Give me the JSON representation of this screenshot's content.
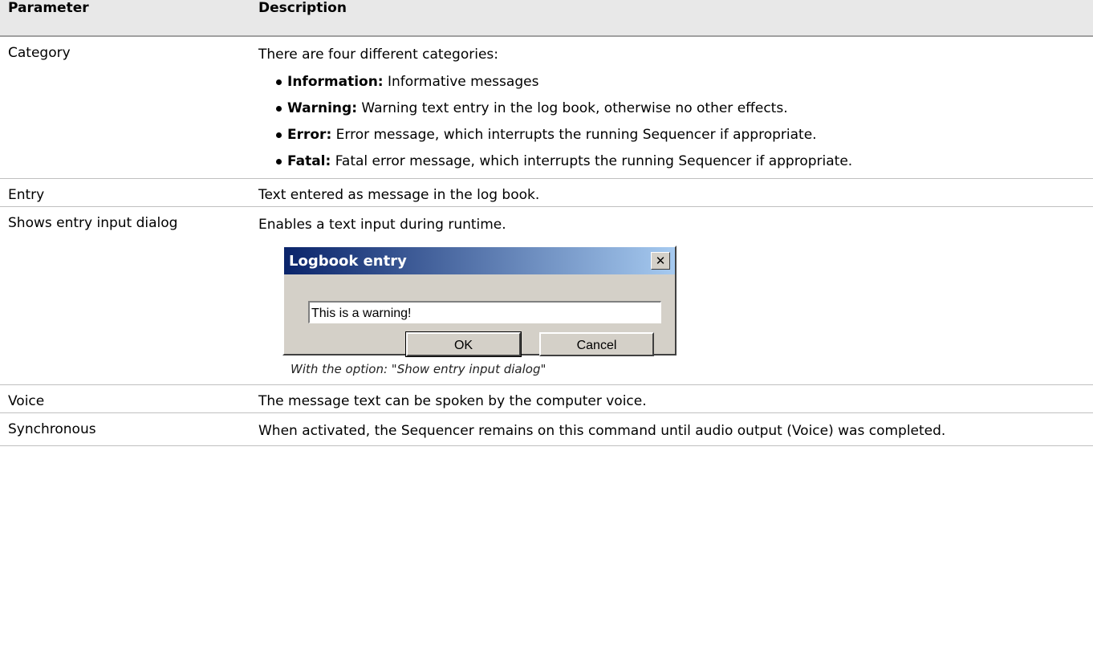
{
  "table": {
    "header": {
      "parameter": "Parameter",
      "description": "Description"
    },
    "category": {
      "label": "Category",
      "intro": "There are four different categories:",
      "items": [
        {
          "term": "Information:",
          "text": " Informative messages"
        },
        {
          "term": "Warning:",
          "text": " Warning text entry in the log book, otherwise no other effects."
        },
        {
          "term": "Error:",
          "text": " Error message, which interrupts the running Sequencer if appropriate."
        },
        {
          "term": "Fatal:",
          "text": " Fatal error message, which interrupts the running Sequencer if appropriate."
        }
      ]
    },
    "entry": {
      "label": "Entry",
      "text": "Text entered as message in the log book."
    },
    "dialog_row": {
      "label": "Shows entry input dialog",
      "text": "Enables a text input during runtime.",
      "caption": "With the option: \"Show entry input dialog\""
    },
    "voice": {
      "label": "Voice",
      "text": "The message text can be spoken by the computer voice."
    },
    "synchronous": {
      "label": "Synchronous",
      "text": "When activated, the Sequencer remains on this command until audio output (Voice) was completed."
    }
  },
  "dialog": {
    "title": "Logbook entry",
    "close_glyph": "✕",
    "input_value": "This is a warning!",
    "ok_label": "OK",
    "cancel_label": "Cancel"
  }
}
